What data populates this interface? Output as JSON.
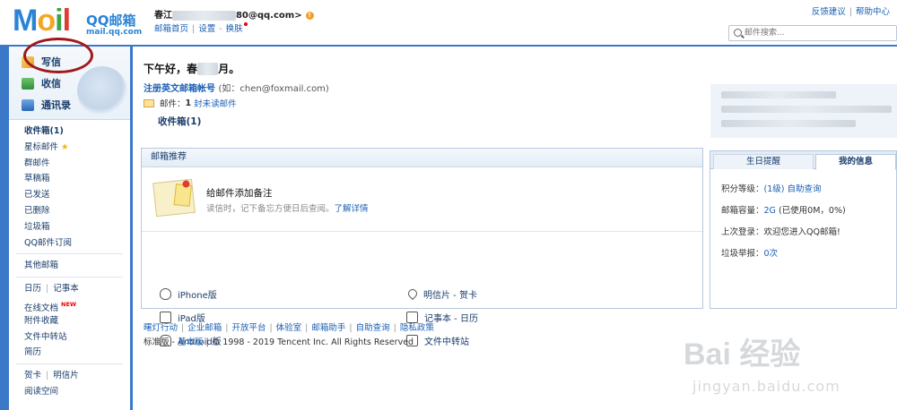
{
  "header": {
    "logo_text": "Mail",
    "logo_cn": "QQ邮箱",
    "logo_domain": "mail.qq.com",
    "user_name": "春江",
    "user_email_suffix": "80@qq.com>",
    "nav": [
      "邮箱首页",
      "设置",
      "换肤"
    ],
    "top_links": [
      "反馈建议",
      "帮助中心"
    ],
    "search_placeholder": "邮件搜索..."
  },
  "sidebar": {
    "quick": [
      {
        "label": "写信",
        "icon": "write-icon"
      },
      {
        "label": "收信",
        "icon": "receive-icon"
      },
      {
        "label": "通讯录",
        "icon": "contacts-icon"
      }
    ],
    "folders": [
      "收件箱(1)",
      "星标邮件",
      "群邮件",
      "草稿箱",
      "已发送",
      "已删除",
      "垃圾箱",
      "QQ邮件订阅"
    ],
    "other": "其他邮箱",
    "calendar": "日历",
    "notebook": "记事本",
    "tools": [
      "在线文档",
      "附件收藏",
      "文件中转站",
      "简历"
    ],
    "new_badge": "NEW",
    "card": "贺卡",
    "postcard": "明信片",
    "reading": "阅读空间"
  },
  "main": {
    "greeting": "下午好，春",
    "greeting_end": "月。",
    "register_label": "注册英文邮箱帐号",
    "register_example": "(如：chen@foxmail.com)",
    "mail_label": "邮件：",
    "mail_count": "1",
    "mail_unread": "封未读邮件",
    "inbox_label": "收件箱(1)"
  },
  "recommend": {
    "title": "邮箱推荐",
    "feature_title": "给邮件添加备注",
    "feature_desc": "读信时，记下备忘方便日后查阅。",
    "feature_link": "了解详情",
    "apps": [
      "iPhone版",
      "iPad版",
      "Android版",
      "明信片 - 贺卡",
      "记事本 - 日历",
      "文件中转站"
    ]
  },
  "info_panel": {
    "tabs": [
      "生日提醒",
      "我的信息"
    ],
    "level_label": "积分等级：",
    "level_value": "(1级)",
    "level_link": "自助查询",
    "capacity_label": "邮箱容量：",
    "capacity_value": "2G",
    "capacity_detail": "(已使用0M，0%)",
    "last_login_label": "上次登录：",
    "last_login_value": "欢迎您进入QQ邮箱!",
    "spam_label": "垃圾举报：",
    "spam_value": "0次"
  },
  "footer": {
    "links": [
      "曙灯行动",
      "企业邮箱",
      "开放平台",
      "体验室",
      "邮箱助手",
      "自助查询",
      "隐私政策"
    ],
    "std_label": "标准版",
    "basic_label": "基本版",
    "copyright": "© 1998 - 2019 Tencent Inc. All Rights Reserved"
  },
  "watermark": {
    "brand": "Bai 经验",
    "url": "jingyan.baidu.com"
  },
  "colors": {
    "frame_blue": "#3b78c8",
    "link_blue": "#1a5fb4",
    "annotation_red": "#a01818"
  }
}
